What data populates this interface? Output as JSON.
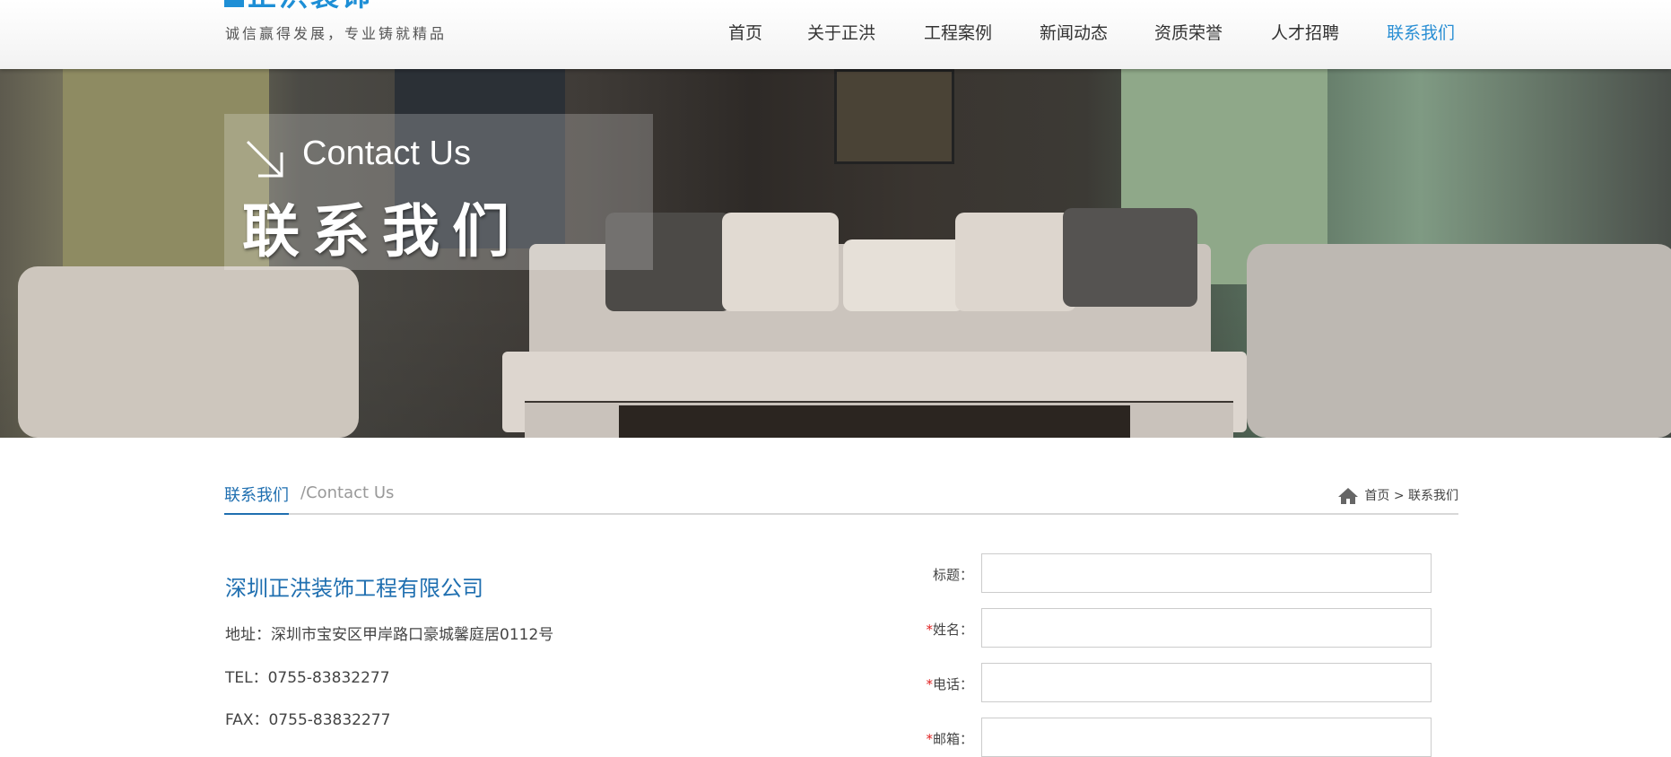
{
  "header": {
    "logo_text": "正洪装饰",
    "slogan": "诚信赢得发展，专业铸就精品",
    "nav": [
      {
        "label": "首页",
        "active": false
      },
      {
        "label": "关于正洪",
        "active": false
      },
      {
        "label": "工程案例",
        "active": false
      },
      {
        "label": "新闻动态",
        "active": false
      },
      {
        "label": "资质荣誉",
        "active": false
      },
      {
        "label": "人才招聘",
        "active": false
      },
      {
        "label": "联系我们",
        "active": true
      }
    ]
  },
  "banner": {
    "caption_en": "Contact Us",
    "caption_cn": "联系我们"
  },
  "section": {
    "title_cn": "联系我们",
    "title_en": "/Contact Us",
    "breadcrumb_home": "首页",
    "breadcrumb_sep": ">",
    "breadcrumb_current": "联系我们"
  },
  "contact": {
    "company": "深圳正洪装饰工程有限公司",
    "address": "地址：深圳市宝安区甲岸路口豪城馨庭居0112号",
    "tel": "TEL：0755-83832277",
    "fax": "FAX：0755-83832277"
  },
  "form": {
    "fields": [
      {
        "label": "标题：",
        "required": false,
        "value": ""
      },
      {
        "label": "姓名：",
        "required": true,
        "value": ""
      },
      {
        "label": "电话：",
        "required": true,
        "value": ""
      },
      {
        "label": "邮箱：",
        "required": true,
        "value": ""
      }
    ],
    "required_mark": "*"
  },
  "colors": {
    "accent": "#2a8fd4",
    "section_blue": "#1f6fb0",
    "required": "#e02020"
  }
}
